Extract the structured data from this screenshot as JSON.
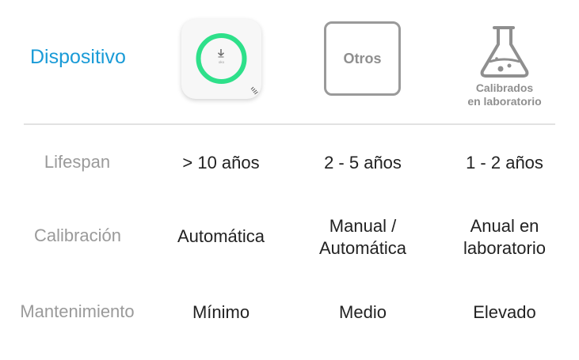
{
  "header": {
    "title": "Dispositivo",
    "device_logo_text": "oko",
    "others_label": "Otros",
    "lab_label_line1": "Calibrados",
    "lab_label_line2": "en laboratorio"
  },
  "rows": [
    {
      "label": "Lifespan",
      "device": "> 10 años",
      "others": "2 - 5 años",
      "lab": "1 - 2 años"
    },
    {
      "label": "Calibración",
      "device": "Automática",
      "others": [
        "Manual /",
        "Automática"
      ],
      "lab": [
        "Anual en",
        "laboratorio"
      ]
    },
    {
      "label": "Mantenimiento",
      "device": "Mínimo",
      "others": "Medio",
      "lab": "Elevado"
    }
  ],
  "colors": {
    "accent_blue": "#1a9bd7",
    "ring_green": "#2ee08a",
    "muted_gray": "#9a9a9a",
    "text_dark": "#222222"
  },
  "icons": {
    "device": "device-card-icon",
    "lab": "flask-icon"
  }
}
